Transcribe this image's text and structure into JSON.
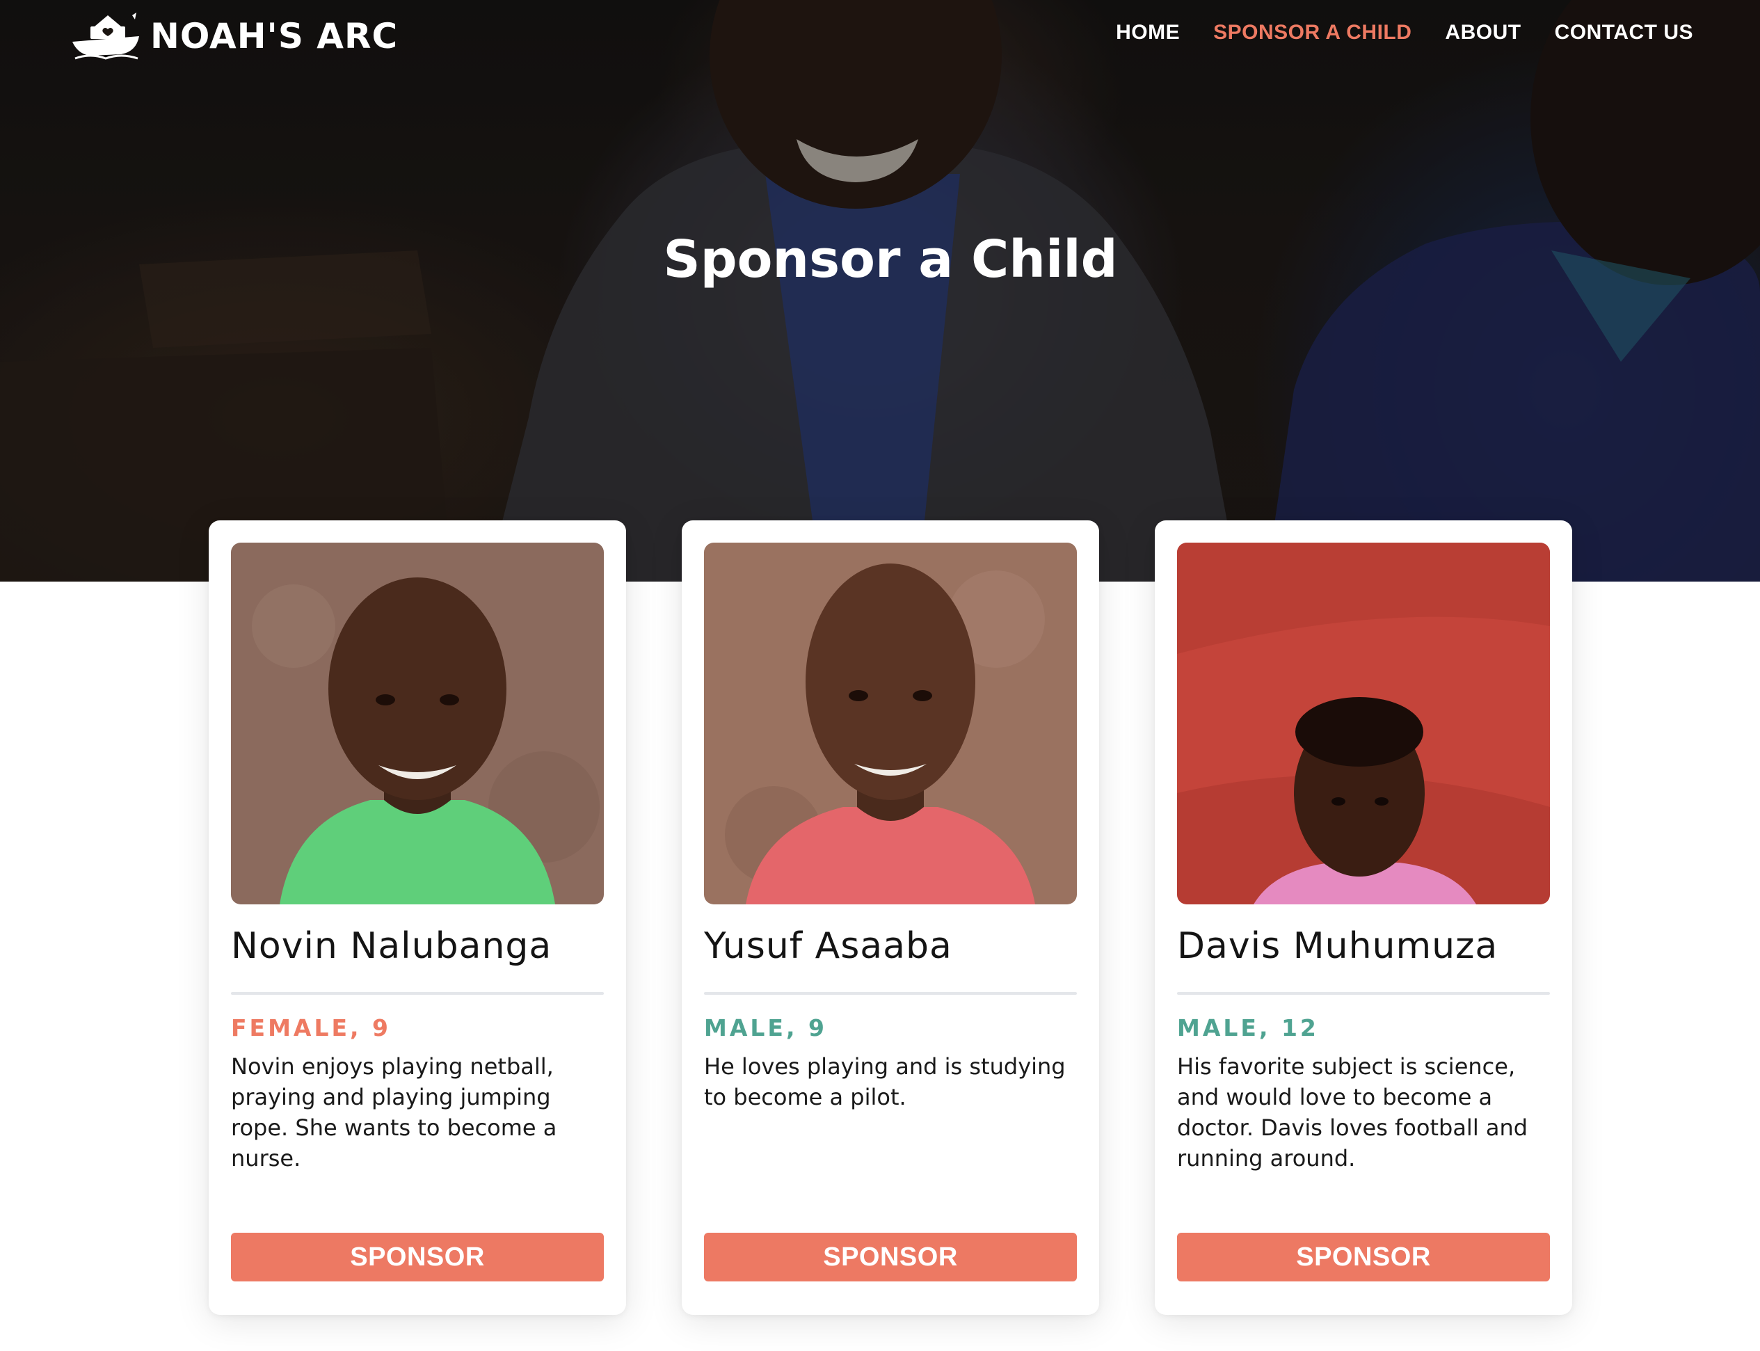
{
  "brand": {
    "name": "NOAH'S ARC",
    "logo_icon": "ark-boat-icon"
  },
  "nav": {
    "items": [
      {
        "label": "HOME",
        "active": false
      },
      {
        "label": "SPONSOR A CHILD",
        "active": true
      },
      {
        "label": "ABOUT",
        "active": false
      },
      {
        "label": "CONTACT US",
        "active": false
      }
    ]
  },
  "hero": {
    "title": "Sponsor a Child"
  },
  "colors": {
    "accent": "#ee7a62",
    "female": "#ee7a62",
    "male": "#4fa391",
    "button": "#ed7963"
  },
  "children": [
    {
      "name": "Novin Nalubanga",
      "meta": "FEMALE, 9",
      "gender": "female",
      "description": "Novin enjoys playing netball, praying and playing jumping rope. She wants to become a nurse.",
      "button": "SPONSOR",
      "shirt_color": "#5fcf7a",
      "background_color": "#8a6a5c"
    },
    {
      "name": "Yusuf Asaaba",
      "meta": "MALE, 9",
      "gender": "male",
      "description": "He loves playing and is studying to become a pilot.",
      "button": "SPONSOR",
      "shirt_color": "#e4666a",
      "background_color": "#9a7260"
    },
    {
      "name": "Davis Muhumuza",
      "meta": "MALE, 12",
      "gender": "male",
      "description": "His favorite subject is science, and would love to become a doctor. Davis loves football and running around.",
      "button": "SPONSOR",
      "shirt_color": "#e58ac0",
      "background_color": "#c4443a"
    }
  ]
}
